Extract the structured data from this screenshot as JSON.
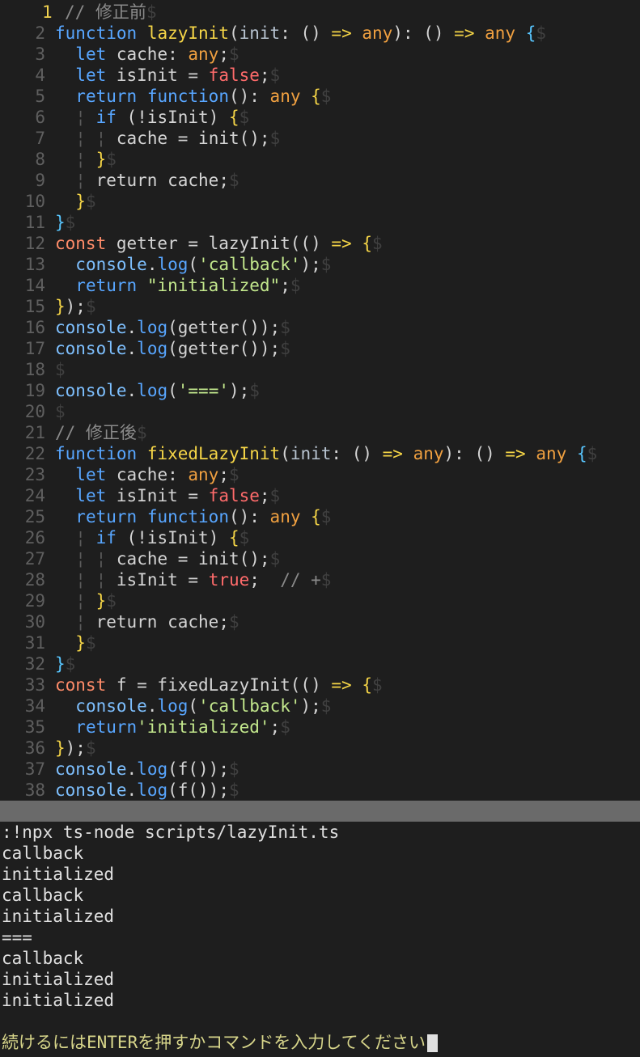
{
  "editor": {
    "current_line": "1",
    "lines": [
      {
        "n": "1",
        "tokens": [
          [
            "cm",
            "// 修正前"
          ],
          [
            "eol",
            "$"
          ]
        ]
      },
      {
        "n": "2",
        "tokens": [
          [
            "kw",
            "function"
          ],
          [
            "plain",
            " "
          ],
          [
            "fn",
            "lazyInit"
          ],
          [
            "plain",
            "("
          ],
          [
            "def",
            "init"
          ],
          [
            "plain",
            ": () "
          ],
          [
            "arrow",
            "=>"
          ],
          [
            "plain",
            " "
          ],
          [
            "ty",
            "any"
          ],
          [
            "plain",
            "): () "
          ],
          [
            "arrow",
            "=>"
          ],
          [
            "plain",
            " "
          ],
          [
            "ty",
            "any"
          ],
          [
            "plain",
            " "
          ],
          [
            "brace2",
            "{"
          ],
          [
            "eol",
            "$"
          ]
        ]
      },
      {
        "n": "3",
        "tokens": [
          [
            "plain",
            "  "
          ],
          [
            "kw",
            "let"
          ],
          [
            "plain",
            " cache: "
          ],
          [
            "ty",
            "any"
          ],
          [
            "plain",
            ";"
          ],
          [
            "eol",
            "$"
          ]
        ]
      },
      {
        "n": "4",
        "tokens": [
          [
            "plain",
            "  "
          ],
          [
            "kw",
            "let"
          ],
          [
            "plain",
            " isInit = "
          ],
          [
            "bool",
            "false"
          ],
          [
            "plain",
            ";"
          ],
          [
            "eol",
            "$"
          ]
        ]
      },
      {
        "n": "5",
        "tokens": [
          [
            "plain",
            "  "
          ],
          [
            "kw",
            "return"
          ],
          [
            "plain",
            " "
          ],
          [
            "kw",
            "function"
          ],
          [
            "plain",
            "(): "
          ],
          [
            "ty",
            "any"
          ],
          [
            "plain",
            " "
          ],
          [
            "brace",
            "{"
          ],
          [
            "eol",
            "$"
          ]
        ]
      },
      {
        "n": "6",
        "tokens": [
          [
            "plain",
            "  "
          ],
          [
            "indent",
            "¦"
          ],
          [
            "plain",
            " "
          ],
          [
            "kw",
            "if"
          ],
          [
            "plain",
            " (!isInit) "
          ],
          [
            "brace",
            "{"
          ],
          [
            "eol",
            "$"
          ]
        ]
      },
      {
        "n": "7",
        "tokens": [
          [
            "plain",
            "  "
          ],
          [
            "indent",
            "¦"
          ],
          [
            "plain",
            " "
          ],
          [
            "indent",
            "¦"
          ],
          [
            "plain",
            " cache = init();"
          ],
          [
            "eol",
            "$"
          ]
        ]
      },
      {
        "n": "8",
        "tokens": [
          [
            "plain",
            "  "
          ],
          [
            "indent",
            "¦"
          ],
          [
            "plain",
            " "
          ],
          [
            "brace",
            "}"
          ],
          [
            "eol",
            "$"
          ]
        ]
      },
      {
        "n": "9",
        "tokens": [
          [
            "plain",
            "  "
          ],
          [
            "indent",
            "¦"
          ],
          [
            "plain",
            " return cache;"
          ],
          [
            "eol",
            "$"
          ]
        ]
      },
      {
        "n": "10",
        "tokens": [
          [
            "plain",
            "  "
          ],
          [
            "brace",
            "}"
          ],
          [
            "eol",
            "$"
          ]
        ]
      },
      {
        "n": "11",
        "tokens": [
          [
            "brace2",
            "}"
          ],
          [
            "eol",
            "$"
          ]
        ]
      },
      {
        "n": "12",
        "tokens": [
          [
            "kw2",
            "const"
          ],
          [
            "plain",
            " getter = lazyInit(() "
          ],
          [
            "arrow",
            "=>"
          ],
          [
            "plain",
            " "
          ],
          [
            "brace",
            "{"
          ],
          [
            "eol",
            "$"
          ]
        ]
      },
      {
        "n": "13",
        "tokens": [
          [
            "plain",
            "  "
          ],
          [
            "cons",
            "console"
          ],
          [
            "plain",
            "."
          ],
          [
            "method",
            "log"
          ],
          [
            "plain",
            "("
          ],
          [
            "str",
            "'callback'"
          ],
          [
            "plain",
            ");"
          ],
          [
            "eol",
            "$"
          ]
        ]
      },
      {
        "n": "14",
        "tokens": [
          [
            "plain",
            "  "
          ],
          [
            "kw",
            "return"
          ],
          [
            "plain",
            " "
          ],
          [
            "str",
            "\"initialized\""
          ],
          [
            "plain",
            ";"
          ],
          [
            "eol",
            "$"
          ]
        ]
      },
      {
        "n": "15",
        "tokens": [
          [
            "brace",
            "}"
          ],
          [
            "plain",
            ");"
          ],
          [
            "eol",
            "$"
          ]
        ]
      },
      {
        "n": "16",
        "tokens": [
          [
            "cons",
            "console"
          ],
          [
            "plain",
            "."
          ],
          [
            "method",
            "log"
          ],
          [
            "plain",
            "(getter());"
          ],
          [
            "eol",
            "$"
          ]
        ]
      },
      {
        "n": "17",
        "tokens": [
          [
            "cons",
            "console"
          ],
          [
            "plain",
            "."
          ],
          [
            "method",
            "log"
          ],
          [
            "plain",
            "(getter());"
          ],
          [
            "eol",
            "$"
          ]
        ]
      },
      {
        "n": "18",
        "tokens": [
          [
            "eol",
            "$"
          ]
        ]
      },
      {
        "n": "19",
        "tokens": [
          [
            "cons",
            "console"
          ],
          [
            "plain",
            "."
          ],
          [
            "method",
            "log"
          ],
          [
            "plain",
            "("
          ],
          [
            "str",
            "'==='"
          ],
          [
            "plain",
            ");"
          ],
          [
            "eol",
            "$"
          ]
        ]
      },
      {
        "n": "20",
        "tokens": [
          [
            "eol",
            "$"
          ]
        ]
      },
      {
        "n": "21",
        "tokens": [
          [
            "cm",
            "// 修正後"
          ],
          [
            "eol",
            "$"
          ]
        ]
      },
      {
        "n": "22",
        "tokens": [
          [
            "kw",
            "function"
          ],
          [
            "plain",
            " "
          ],
          [
            "fn",
            "fixedLazyInit"
          ],
          [
            "plain",
            "("
          ],
          [
            "def",
            "init"
          ],
          [
            "plain",
            ": () "
          ],
          [
            "arrow",
            "=>"
          ],
          [
            "plain",
            " "
          ],
          [
            "ty",
            "any"
          ],
          [
            "plain",
            "): () "
          ],
          [
            "arrow",
            "=>"
          ],
          [
            "plain",
            " "
          ],
          [
            "ty",
            "any"
          ],
          [
            "plain",
            " "
          ],
          [
            "brace2",
            "{"
          ],
          [
            "eol",
            "$"
          ]
        ]
      },
      {
        "n": "23",
        "tokens": [
          [
            "plain",
            "  "
          ],
          [
            "kw",
            "let"
          ],
          [
            "plain",
            " cache: "
          ],
          [
            "ty",
            "any"
          ],
          [
            "plain",
            ";"
          ],
          [
            "eol",
            "$"
          ]
        ]
      },
      {
        "n": "24",
        "tokens": [
          [
            "plain",
            "  "
          ],
          [
            "kw",
            "let"
          ],
          [
            "plain",
            " isInit = "
          ],
          [
            "bool",
            "false"
          ],
          [
            "plain",
            ";"
          ],
          [
            "eol",
            "$"
          ]
        ]
      },
      {
        "n": "25",
        "tokens": [
          [
            "plain",
            "  "
          ],
          [
            "kw",
            "return"
          ],
          [
            "plain",
            " "
          ],
          [
            "kw",
            "function"
          ],
          [
            "plain",
            "(): "
          ],
          [
            "ty",
            "any"
          ],
          [
            "plain",
            " "
          ],
          [
            "brace",
            "{"
          ],
          [
            "eol",
            "$"
          ]
        ]
      },
      {
        "n": "26",
        "tokens": [
          [
            "plain",
            "  "
          ],
          [
            "indent",
            "¦"
          ],
          [
            "plain",
            " "
          ],
          [
            "kw",
            "if"
          ],
          [
            "plain",
            " (!isInit) "
          ],
          [
            "brace",
            "{"
          ],
          [
            "eol",
            "$"
          ]
        ]
      },
      {
        "n": "27",
        "tokens": [
          [
            "plain",
            "  "
          ],
          [
            "indent",
            "¦"
          ],
          [
            "plain",
            " "
          ],
          [
            "indent",
            "¦"
          ],
          [
            "plain",
            " cache = init();"
          ],
          [
            "eol",
            "$"
          ]
        ]
      },
      {
        "n": "28",
        "tokens": [
          [
            "plain",
            "  "
          ],
          [
            "indent",
            "¦"
          ],
          [
            "plain",
            " "
          ],
          [
            "indent",
            "¦"
          ],
          [
            "plain",
            " isInit = "
          ],
          [
            "bool",
            "true"
          ],
          [
            "plain",
            ";  "
          ],
          [
            "cm",
            "// +"
          ],
          [
            "eol",
            "$"
          ]
        ]
      },
      {
        "n": "29",
        "tokens": [
          [
            "plain",
            "  "
          ],
          [
            "indent",
            "¦"
          ],
          [
            "plain",
            " "
          ],
          [
            "brace",
            "}"
          ],
          [
            "eol",
            "$"
          ]
        ]
      },
      {
        "n": "30",
        "tokens": [
          [
            "plain",
            "  "
          ],
          [
            "indent",
            "¦"
          ],
          [
            "plain",
            " return cache;"
          ],
          [
            "eol",
            "$"
          ]
        ]
      },
      {
        "n": "31",
        "tokens": [
          [
            "plain",
            "  "
          ],
          [
            "brace",
            "}"
          ],
          [
            "eol",
            "$"
          ]
        ]
      },
      {
        "n": "32",
        "tokens": [
          [
            "brace2",
            "}"
          ],
          [
            "eol",
            "$"
          ]
        ]
      },
      {
        "n": "33",
        "tokens": [
          [
            "kw2",
            "const"
          ],
          [
            "plain",
            " f = fixedLazyInit(() "
          ],
          [
            "arrow",
            "=>"
          ],
          [
            "plain",
            " "
          ],
          [
            "brace",
            "{"
          ],
          [
            "eol",
            "$"
          ]
        ]
      },
      {
        "n": "34",
        "tokens": [
          [
            "plain",
            "  "
          ],
          [
            "cons",
            "console"
          ],
          [
            "plain",
            "."
          ],
          [
            "method",
            "log"
          ],
          [
            "plain",
            "("
          ],
          [
            "str",
            "'callback'"
          ],
          [
            "plain",
            ");"
          ],
          [
            "eol",
            "$"
          ]
        ]
      },
      {
        "n": "35",
        "tokens": [
          [
            "plain",
            "  "
          ],
          [
            "kw",
            "return"
          ],
          [
            "str",
            "'initialized'"
          ],
          [
            "plain",
            ";"
          ],
          [
            "eol",
            "$"
          ]
        ]
      },
      {
        "n": "36",
        "tokens": [
          [
            "brace",
            "}"
          ],
          [
            "plain",
            ");"
          ],
          [
            "eol",
            "$"
          ]
        ]
      },
      {
        "n": "37",
        "tokens": [
          [
            "cons",
            "console"
          ],
          [
            "plain",
            "."
          ],
          [
            "method",
            "log"
          ],
          [
            "plain",
            "(f());"
          ],
          [
            "eol",
            "$"
          ]
        ]
      },
      {
        "n": "38",
        "tokens": [
          [
            "cons",
            "console"
          ],
          [
            "plain",
            "."
          ],
          [
            "method",
            "log"
          ],
          [
            "plain",
            "(f());"
          ],
          [
            "eol",
            "$"
          ]
        ]
      }
    ]
  },
  "terminal": {
    "lines": [
      ":!npx ts-node scripts/lazyInit.ts",
      "callback",
      "initialized",
      "callback",
      "initialized",
      "===",
      "callback",
      "initialized",
      "initialized"
    ],
    "prompt": "続けるにはENTERを押すかコマンドを入力してください"
  },
  "colors": {
    "background": "#1e1e1e",
    "statusbar": "#6a6a6a",
    "keyword": "#58a6ff",
    "function_name": "#f5d547",
    "type": "#f0a040",
    "boolean": "#ff6b6b",
    "string": "#c3e88d",
    "comment": "#8a8a8a",
    "prompt_text": "#d7d58a",
    "current_line_number": "#f0d14f"
  }
}
